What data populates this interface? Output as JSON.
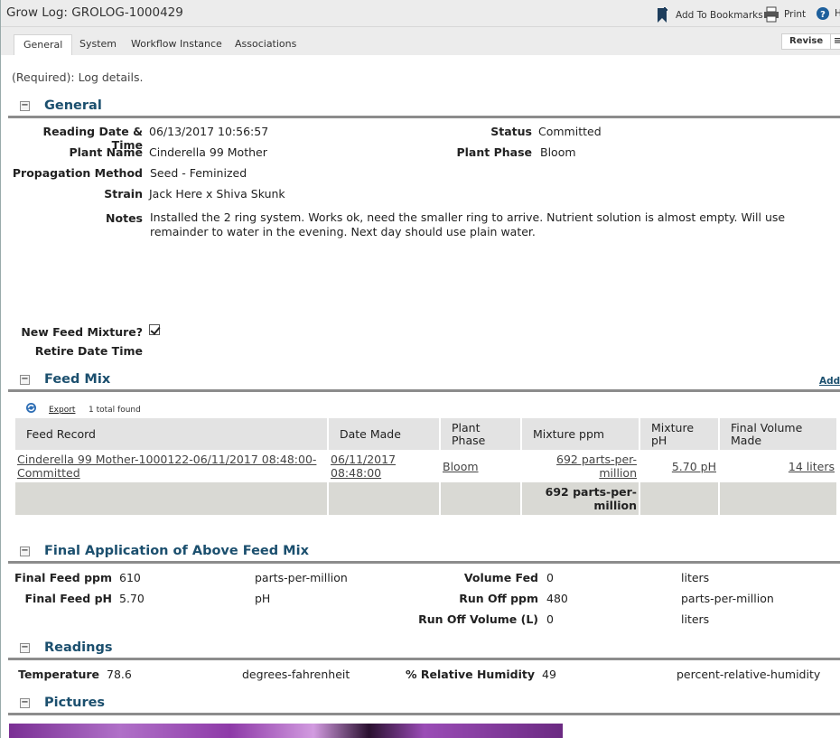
{
  "window": {
    "title": "Grow Log: GROLOG-1000429",
    "actions": [
      {
        "label": "Add To Bookmarks",
        "icon": "bookmark-icon"
      },
      {
        "label": "Print",
        "icon": "printer-icon"
      },
      {
        "label": "H",
        "icon": "help-icon"
      }
    ]
  },
  "tabs": [
    "General",
    "System",
    "Workflow Instance",
    "Associations"
  ],
  "toolbar": {
    "revise_label": "Revise",
    "more_label": "≡"
  },
  "required_note": "(Required): Log details.",
  "general": {
    "section_title": "General",
    "reading_date_label": "Reading Date & Time",
    "reading_date_value": "06/13/2017 10:56:57",
    "status_label": "Status",
    "status_value": "Committed",
    "plant_name_label": "Plant Name",
    "plant_name_value": "Cinderella 99 Mother",
    "plant_phase_label": "Plant Phase",
    "plant_phase_value": "Bloom",
    "propagation_label": "Propagation Method",
    "propagation_value": "Seed - Feminized",
    "strain_label": "Strain",
    "strain_value": "Jack Here x Shiva Skunk",
    "notes_label": "Notes",
    "notes_value": "Installed the 2 ring system.  Works ok, need the smaller ring to arrive.  Nutrient solution is almost empty.  Will use remainder to water in the evening.  Next day should use plain water.",
    "new_feed_label": "New Feed Mixture?",
    "new_feed_checked": true,
    "retire_label": "Retire Date Time",
    "retire_value": ""
  },
  "feed_mix": {
    "section_title": "Feed Mix",
    "add_label": "Add",
    "export_label": "Export",
    "total_found": "1 total found",
    "columns": [
      "Feed Record",
      "Date Made",
      "Plant Phase",
      "Mixture ppm",
      "Mixture pH",
      "Final Volume Made"
    ],
    "rows": [
      {
        "feed_record": "Cinderella 99 Mother-1000122-06/11/2017 08:48:00-Committed",
        "date_made": "06/11/2017 08:48:00",
        "plant_phase": "Bloom",
        "mixture_ppm": "692 parts-per-million",
        "mixture_ph": "5.70 pH",
        "final_volume": "14 liters"
      }
    ],
    "total_ppm": "692 parts-per-million"
  },
  "final_application": {
    "section_title": "Final Application of Above Feed Mix",
    "final_feed_ppm_label": "Final Feed ppm",
    "final_feed_ppm_value": "610",
    "final_feed_ppm_unit": "parts-per-million",
    "volume_fed_label": "Volume Fed",
    "volume_fed_value": "0",
    "volume_fed_unit": "liters",
    "final_feed_ph_label": "Final Feed pH",
    "final_feed_ph_value": "5.70",
    "final_feed_ph_unit": "pH",
    "run_off_ppm_label": "Run Off ppm",
    "run_off_ppm_value": "480",
    "run_off_ppm_unit": "parts-per-million",
    "run_off_volume_label": "Run Off Volume (L)",
    "run_off_volume_value": "0",
    "run_off_volume_unit": "liters"
  },
  "readings": {
    "section_title": "Readings",
    "temperature_label": "Temperature",
    "temperature_value": "78.6",
    "temperature_unit": "degrees-fahrenheit",
    "humidity_label": "% Relative Humidity",
    "humidity_value": "49",
    "humidity_unit": "percent-relative-humidity"
  },
  "pictures": {
    "section_title": "Pictures"
  },
  "colors": {
    "section_title": "#1b4f6e",
    "photo_purple": "#8e3aa8"
  }
}
